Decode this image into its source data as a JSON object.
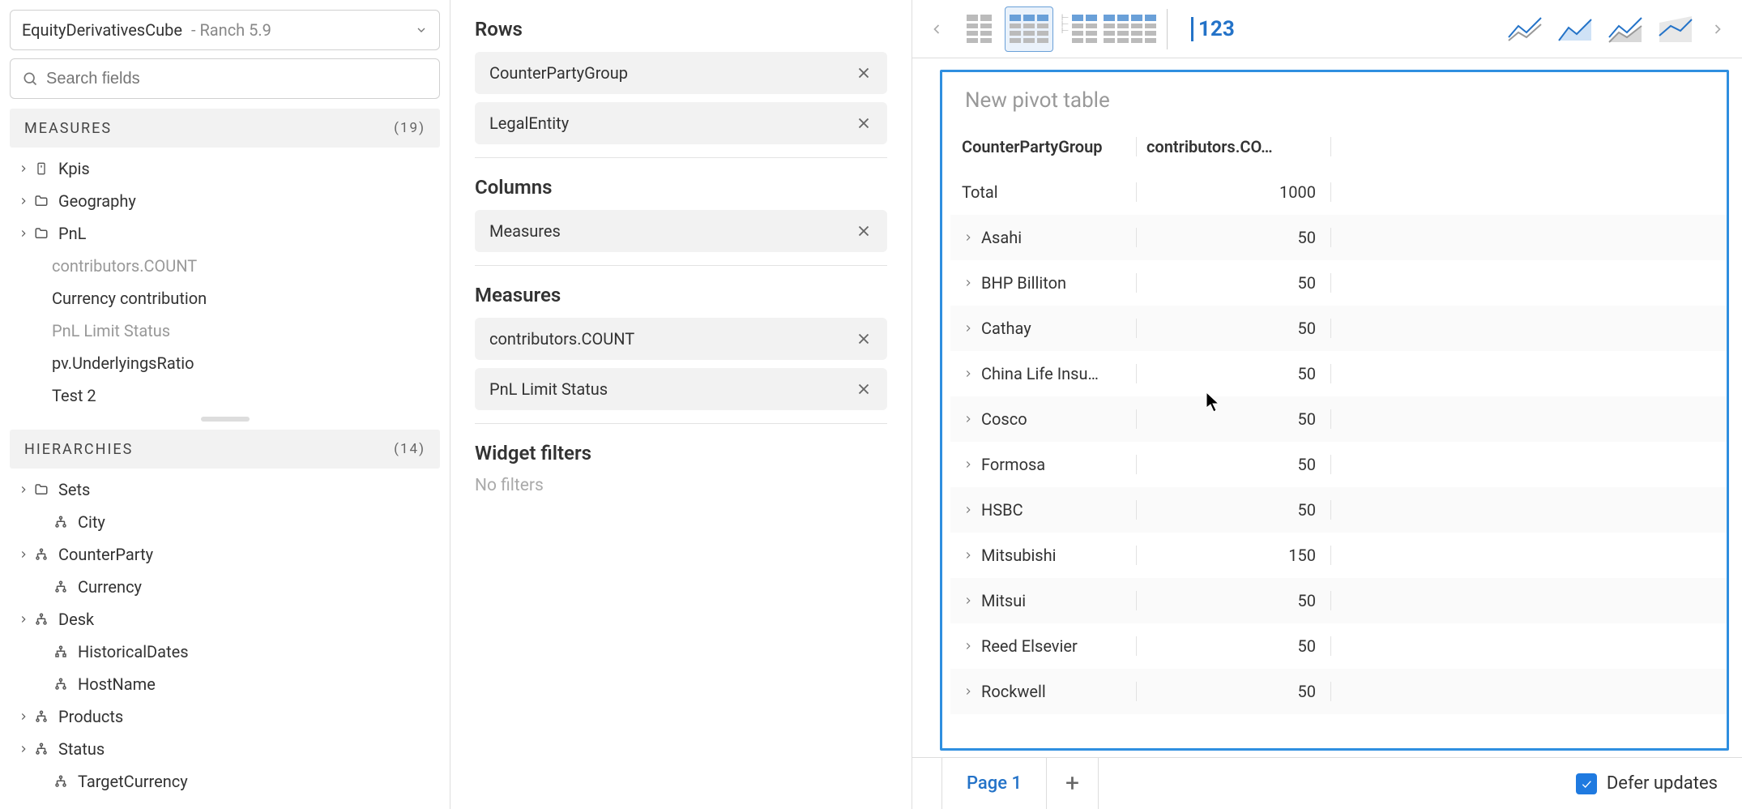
{
  "cube": {
    "name": "EquityDerivativesCube",
    "sub": " - Ranch 5.9"
  },
  "search": {
    "placeholder": "Search fields"
  },
  "measures_section": {
    "title": "MEASURES",
    "count": "(19)"
  },
  "measures_tree": [
    {
      "label": "Kpis",
      "caret": true,
      "icon": "kpi",
      "muted": false
    },
    {
      "label": "Geography",
      "caret": true,
      "icon": "folder",
      "muted": false
    },
    {
      "label": "PnL",
      "caret": true,
      "icon": "folder",
      "muted": false
    },
    {
      "label": "contributors.COUNT",
      "caret": false,
      "icon": "",
      "muted": true,
      "indent": true
    },
    {
      "label": "Currency contribution",
      "caret": false,
      "icon": "",
      "muted": false,
      "indent": true
    },
    {
      "label": "PnL Limit Status",
      "caret": false,
      "icon": "",
      "muted": true,
      "indent": true
    },
    {
      "label": "pv.UnderlyingsRatio",
      "caret": false,
      "icon": "",
      "muted": false,
      "indent": true
    },
    {
      "label": "Test 2",
      "caret": false,
      "icon": "",
      "muted": false,
      "indent": true
    }
  ],
  "hierarchies_section": {
    "title": "HIERARCHIES",
    "count": "(14)"
  },
  "hierarchies_tree": [
    {
      "label": "Sets",
      "caret": true,
      "icon": "folder"
    },
    {
      "label": "City",
      "caret": false,
      "icon": "hier",
      "indent": true
    },
    {
      "label": "CounterParty",
      "caret": true,
      "icon": "hier"
    },
    {
      "label": "Currency",
      "caret": false,
      "icon": "hier",
      "indent": true
    },
    {
      "label": "Desk",
      "caret": true,
      "icon": "hier"
    },
    {
      "label": "HistoricalDates",
      "caret": false,
      "icon": "hier-d",
      "indent": true
    },
    {
      "label": "HostName",
      "caret": false,
      "icon": "hier",
      "indent": true
    },
    {
      "label": "Products",
      "caret": true,
      "icon": "hier"
    },
    {
      "label": "Status",
      "caret": true,
      "icon": "hier"
    },
    {
      "label": "TargetCurrency",
      "caret": false,
      "icon": "hier",
      "indent": true
    }
  ],
  "zones": {
    "rows_title": "Rows",
    "rows": [
      "CounterPartyGroup",
      "LegalEntity"
    ],
    "columns_title": "Columns",
    "columns": [
      "Measures"
    ],
    "measures_title": "Measures",
    "measures": [
      "contributors.COUNT",
      "PnL Limit Status"
    ],
    "filters_title": "Widget filters",
    "no_filters": "No filters"
  },
  "toolbar": {
    "num_label": "123"
  },
  "pivot": {
    "title": "New pivot table",
    "col1": "CounterPartyGroup",
    "col2": "contributors.CO…",
    "total_label": "Total",
    "total_value": "1000",
    "rows": [
      {
        "label": "Asahi",
        "value": "50"
      },
      {
        "label": "BHP Billiton",
        "value": "50"
      },
      {
        "label": "Cathay",
        "value": "50"
      },
      {
        "label": "China Life Insu…",
        "value": "50"
      },
      {
        "label": "Cosco",
        "value": "50"
      },
      {
        "label": "Formosa",
        "value": "50"
      },
      {
        "label": "HSBC",
        "value": "50"
      },
      {
        "label": "Mitsubishi",
        "value": "150"
      },
      {
        "label": "Mitsui",
        "value": "50"
      },
      {
        "label": "Reed Elsevier",
        "value": "50"
      },
      {
        "label": "Rockwell",
        "value": "50"
      }
    ]
  },
  "footer": {
    "page_label": "Page 1",
    "defer_label": "Defer updates"
  }
}
